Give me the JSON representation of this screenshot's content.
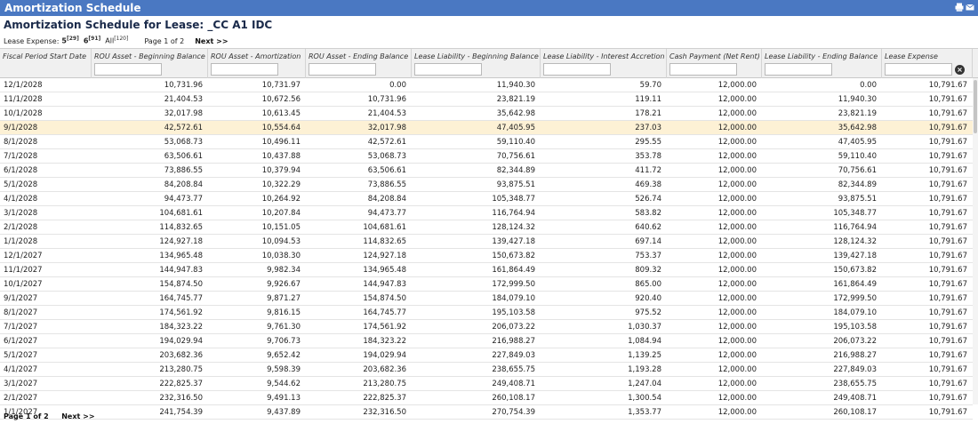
{
  "window": {
    "title": "Amortization Schedule",
    "icons": [
      "printer-icon",
      "email-icon"
    ]
  },
  "page_title": "Amortization Schedule for Lease: _CC A1 IDC",
  "pager": {
    "lease_expense_label": "Lease Expense:",
    "options": [
      {
        "label": "5",
        "count": "[29]",
        "bold": true
      },
      {
        "label": "6",
        "count": "[91]",
        "bold": true
      },
      {
        "label": "All",
        "count": "[120]",
        "bold": false
      }
    ],
    "page_info": "Page 1 of 2",
    "next_label": "Next >>"
  },
  "columns": [
    "Fiscal Period Start Date",
    "ROU Asset - Beginning Balance",
    "ROU Asset - Amortization",
    "ROU Asset - Ending Balance",
    "Lease Liability - Beginning Balance",
    "Lease Liability - Interest Accretion",
    "Cash Payment (Net Rent)",
    "Lease Liability - Ending Balance",
    "Lease Expense"
  ],
  "highlighted_row": 3,
  "rows": [
    [
      "12/1/2028",
      "10,731.96",
      "10,731.97",
      "0.00",
      "11,940.30",
      "59.70",
      "12,000.00",
      "0.00",
      "10,791.67"
    ],
    [
      "11/1/2028",
      "21,404.53",
      "10,672.56",
      "10,731.96",
      "23,821.19",
      "119.11",
      "12,000.00",
      "11,940.30",
      "10,791.67"
    ],
    [
      "10/1/2028",
      "32,017.98",
      "10,613.45",
      "21,404.53",
      "35,642.98",
      "178.21",
      "12,000.00",
      "23,821.19",
      "10,791.67"
    ],
    [
      "9/1/2028",
      "42,572.61",
      "10,554.64",
      "32,017.98",
      "47,405.95",
      "237.03",
      "12,000.00",
      "35,642.98",
      "10,791.67"
    ],
    [
      "8/1/2028",
      "53,068.73",
      "10,496.11",
      "42,572.61",
      "59,110.40",
      "295.55",
      "12,000.00",
      "47,405.95",
      "10,791.67"
    ],
    [
      "7/1/2028",
      "63,506.61",
      "10,437.88",
      "53,068.73",
      "70,756.61",
      "353.78",
      "12,000.00",
      "59,110.40",
      "10,791.67"
    ],
    [
      "6/1/2028",
      "73,886.55",
      "10,379.94",
      "63,506.61",
      "82,344.89",
      "411.72",
      "12,000.00",
      "70,756.61",
      "10,791.67"
    ],
    [
      "5/1/2028",
      "84,208.84",
      "10,322.29",
      "73,886.55",
      "93,875.51",
      "469.38",
      "12,000.00",
      "82,344.89",
      "10,791.67"
    ],
    [
      "4/1/2028",
      "94,473.77",
      "10,264.92",
      "84,208.84",
      "105,348.77",
      "526.74",
      "12,000.00",
      "93,875.51",
      "10,791.67"
    ],
    [
      "3/1/2028",
      "104,681.61",
      "10,207.84",
      "94,473.77",
      "116,764.94",
      "583.82",
      "12,000.00",
      "105,348.77",
      "10,791.67"
    ],
    [
      "2/1/2028",
      "114,832.65",
      "10,151.05",
      "104,681.61",
      "128,124.32",
      "640.62",
      "12,000.00",
      "116,764.94",
      "10,791.67"
    ],
    [
      "1/1/2028",
      "124,927.18",
      "10,094.53",
      "114,832.65",
      "139,427.18",
      "697.14",
      "12,000.00",
      "128,124.32",
      "10,791.67"
    ],
    [
      "12/1/2027",
      "134,965.48",
      "10,038.30",
      "124,927.18",
      "150,673.82",
      "753.37",
      "12,000.00",
      "139,427.18",
      "10,791.67"
    ],
    [
      "11/1/2027",
      "144,947.83",
      "9,982.34",
      "134,965.48",
      "161,864.49",
      "809.32",
      "12,000.00",
      "150,673.82",
      "10,791.67"
    ],
    [
      "10/1/2027",
      "154,874.50",
      "9,926.67",
      "144,947.83",
      "172,999.50",
      "865.00",
      "12,000.00",
      "161,864.49",
      "10,791.67"
    ],
    [
      "9/1/2027",
      "164,745.77",
      "9,871.27",
      "154,874.50",
      "184,079.10",
      "920.40",
      "12,000.00",
      "172,999.50",
      "10,791.67"
    ],
    [
      "8/1/2027",
      "174,561.92",
      "9,816.15",
      "164,745.77",
      "195,103.58",
      "975.52",
      "12,000.00",
      "184,079.10",
      "10,791.67"
    ],
    [
      "7/1/2027",
      "184,323.22",
      "9,761.30",
      "174,561.92",
      "206,073.22",
      "1,030.37",
      "12,000.00",
      "195,103.58",
      "10,791.67"
    ],
    [
      "6/1/2027",
      "194,029.94",
      "9,706.73",
      "184,323.22",
      "216,988.27",
      "1,084.94",
      "12,000.00",
      "206,073.22",
      "10,791.67"
    ],
    [
      "5/1/2027",
      "203,682.36",
      "9,652.42",
      "194,029.94",
      "227,849.03",
      "1,139.25",
      "12,000.00",
      "216,988.27",
      "10,791.67"
    ],
    [
      "4/1/2027",
      "213,280.75",
      "9,598.39",
      "203,682.36",
      "238,655.75",
      "1,193.28",
      "12,000.00",
      "227,849.03",
      "10,791.67"
    ],
    [
      "3/1/2027",
      "222,825.37",
      "9,544.62",
      "213,280.75",
      "249,408.71",
      "1,247.04",
      "12,000.00",
      "238,655.75",
      "10,791.67"
    ],
    [
      "2/1/2027",
      "232,316.50",
      "9,491.13",
      "222,825.37",
      "260,108.17",
      "1,300.54",
      "12,000.00",
      "249,408.71",
      "10,791.67"
    ],
    [
      "1/1/2027",
      "241,754.39",
      "9,437.89",
      "232,316.50",
      "270,754.39",
      "1,353.77",
      "12,000.00",
      "260,108.17",
      "10,791.67"
    ]
  ]
}
